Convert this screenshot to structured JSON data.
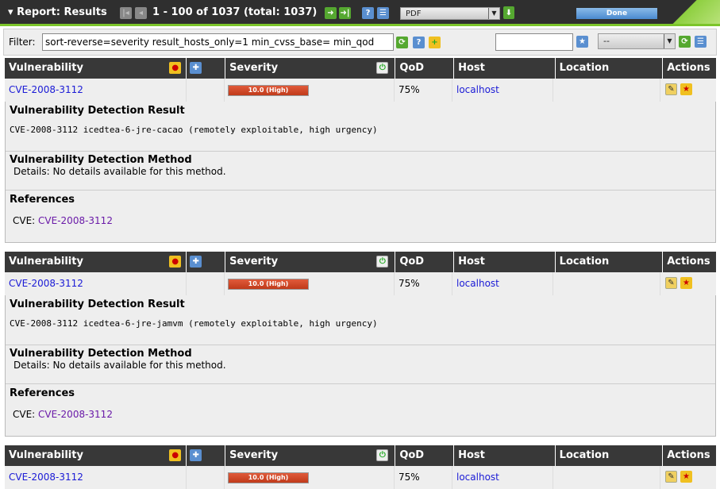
{
  "header": {
    "title": "Report: Results",
    "count": "1 - 100 of 1037 (total: 1037)",
    "format": "PDF",
    "done": "Done"
  },
  "filter": {
    "label": "Filter:",
    "value": "sort-reverse=severity result_hosts_only=1 min_cvss_base= min_qod",
    "name_value": "",
    "select_value": "--"
  },
  "columns": [
    "Vulnerability",
    "",
    "Severity",
    "QoD",
    "Host",
    "Location",
    "Actions"
  ],
  "labels": {
    "result": "Vulnerability Detection Result",
    "method": "Vulnerability Detection Method",
    "method_detail": "Details: No details available for this method.",
    "refs": "References",
    "cve_prefix": "CVE:"
  },
  "results": [
    {
      "name": "CVE-2008-3112",
      "severity": "10.0 (High)",
      "qod": "75%",
      "host": "localhost",
      "location": "",
      "output": "CVE-2008-3112 icedtea-6-jre-cacao (remotely exploitable, high urgency)",
      "ref": "CVE-2008-3112"
    },
    {
      "name": "CVE-2008-3112",
      "severity": "10.0 (High)",
      "qod": "75%",
      "host": "localhost",
      "location": "",
      "output": "CVE-2008-3112 icedtea-6-jre-jamvm (remotely exploitable, high urgency)",
      "ref": "CVE-2008-3112"
    },
    {
      "name": "CVE-2008-3112",
      "severity": "10.0 (High)",
      "qod": "75%",
      "host": "localhost",
      "location": ""
    }
  ]
}
